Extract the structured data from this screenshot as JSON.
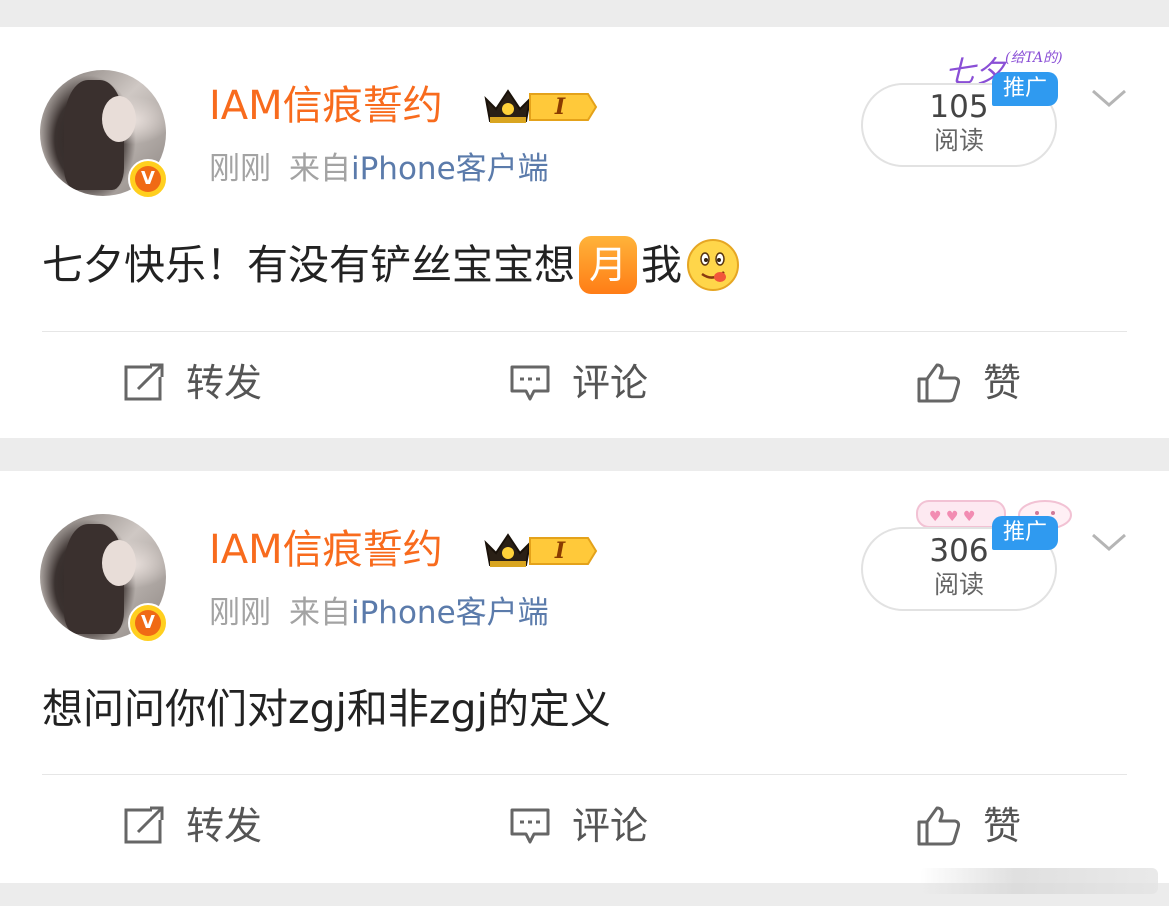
{
  "posts": [
    {
      "username": "IAM信痕誓约",
      "level_label": "I",
      "time": "刚刚",
      "from_label": "来自",
      "device": "iPhone客户端",
      "promo_art_text": "七夕",
      "promo_art_small": "(给TA的)",
      "promo_tag": "推广",
      "read_count": "105",
      "read_label": "阅读",
      "text_before": "七夕快乐！有没有铲丝宝宝想",
      "emoji_moon": "月",
      "text_after": "我",
      "emoji_face": "tongue-face-emoji",
      "actions": {
        "repost": "转发",
        "comment": "评论",
        "like": "赞"
      }
    },
    {
      "username": "IAM信痕誓约",
      "level_label": "I",
      "time": "刚刚",
      "from_label": "来自",
      "device": "iPhone客户端",
      "promo_tag": "推广",
      "read_count": "306",
      "read_label": "阅读",
      "text": "想问问你们对zgj和非zgj的定义",
      "actions": {
        "repost": "转发",
        "comment": "评论",
        "like": "赞"
      }
    }
  ],
  "colors": {
    "username": "#f86b1d",
    "device_link": "#5b7bab",
    "promo_tag": "#2f9af0",
    "verified_badge": "#ffcf1f",
    "page_background": "#ececec"
  },
  "icons": {
    "verified": "v-verified-icon",
    "crown": "crown-icon",
    "chevron": "chevron-down-icon",
    "repost": "repost-icon",
    "comment": "comment-icon",
    "like": "thumbs-up-icon"
  }
}
